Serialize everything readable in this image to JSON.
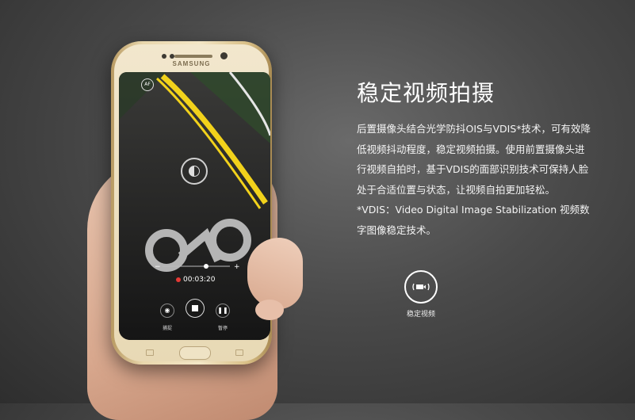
{
  "phone": {
    "brand": "SAMSUNG",
    "screen": {
      "af_badge": "AF",
      "timer": "00:03:20",
      "capture_label": "捕捉",
      "pause_label": "暂停"
    }
  },
  "content": {
    "title": "稳定视频拍摄",
    "lines": [
      "后置摄像头结合光学防抖OIS与VDIS*技术，可有效降",
      "低视频抖动程度，稳定视频拍摄。使用前置摄像头进",
      "行视频自拍时，基于VDIS的面部识别技术可保持人脸",
      "处于合适位置与状态，让视频自拍更加轻松。",
      "*VDIS：Video Digital Image Stabilization 视频数",
      "字图像稳定技术。"
    ]
  },
  "feature": {
    "icon": "video-stabilization-icon",
    "label": "稳定视频"
  },
  "colors": {
    "road_line": "#f2d21b",
    "record_red": "#e53935",
    "background": "#4a4a4a"
  }
}
